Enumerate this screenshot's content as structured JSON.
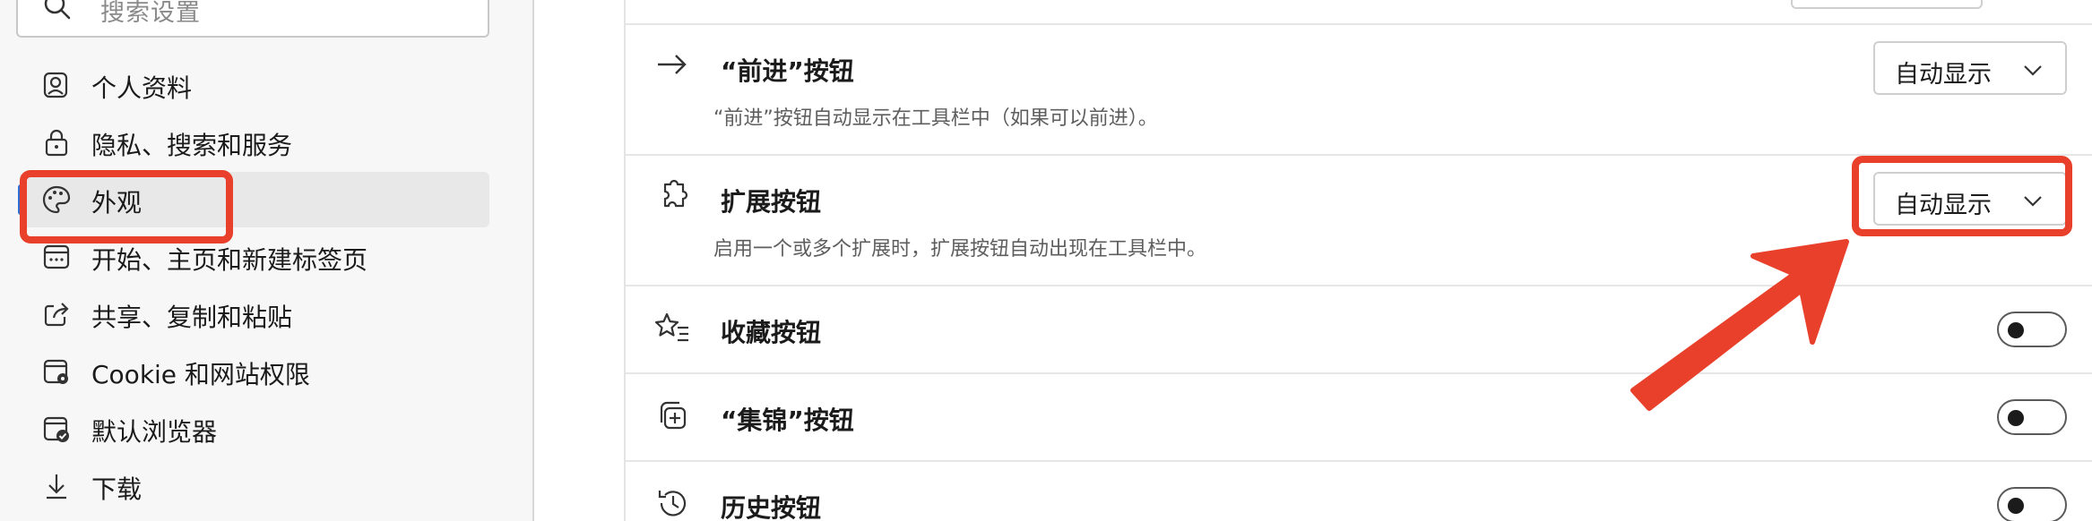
{
  "sidebar": {
    "search_placeholder": "搜索设置",
    "items": [
      {
        "label": "个人资料",
        "icon": "profile-icon"
      },
      {
        "label": "隐私、搜索和服务",
        "icon": "lock-icon"
      },
      {
        "label": "外观",
        "icon": "palette-icon",
        "selected": true
      },
      {
        "label": "开始、主页和新建标签页",
        "icon": "start-page-icon"
      },
      {
        "label": "共享、复制和粘贴",
        "icon": "share-icon"
      },
      {
        "label": "Cookie 和网站权限",
        "icon": "cookie-permissions-icon"
      },
      {
        "label": "默认浏览器",
        "icon": "default-browser-icon"
      },
      {
        "label": "下载",
        "icon": "download-icon"
      }
    ]
  },
  "main": {
    "rows": [
      {
        "title": "“前进”按钮",
        "desc": "“前进”按钮自动显示在工具栏中（如果可以前进）。",
        "control": "dropdown",
        "value": "自动显示",
        "icon": "forward-arrow-icon"
      },
      {
        "title": "扩展按钮",
        "desc": "启用一个或多个扩展时，扩展按钮自动出现在工具栏中。",
        "control": "dropdown",
        "value": "自动显示",
        "icon": "extensions-icon"
      },
      {
        "title": "收藏按钮",
        "control": "toggle",
        "on": false,
        "icon": "favorites-icon"
      },
      {
        "title": "“集锦”按钮",
        "control": "toggle",
        "on": false,
        "icon": "collections-icon"
      },
      {
        "title": "历史按钮",
        "control": "toggle",
        "on": false,
        "icon": "history-icon"
      }
    ]
  },
  "annotation": {
    "color": "#e8402b"
  },
  "colors": {
    "accent": "#2f6fd6",
    "sidebar_bg": "#f7f7f7",
    "selected_bg": "#e8e8e8"
  }
}
